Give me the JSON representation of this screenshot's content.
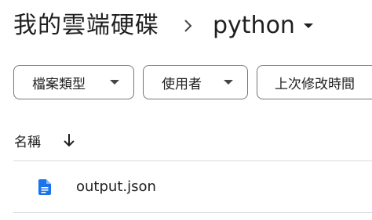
{
  "breadcrumb": {
    "root": "我的雲端硬碟",
    "current": "python"
  },
  "filters": {
    "type": "檔案類型",
    "owner": "使用者",
    "modified": "上次修改時間"
  },
  "list_header": {
    "name_column": "名稱"
  },
  "files": [
    {
      "name": "output.json"
    }
  ],
  "colors": {
    "text": "#1f1f1f",
    "file_icon": "#1a73e8",
    "border": "#747775",
    "divider": "#dadce0"
  },
  "icons": {
    "breadcrumb_separator": "chevron-right-icon",
    "folder_menu": "caret-down-icon",
    "chip_menu": "caret-down-icon",
    "sort": "arrow-down-icon",
    "file": "docs-file-icon"
  }
}
